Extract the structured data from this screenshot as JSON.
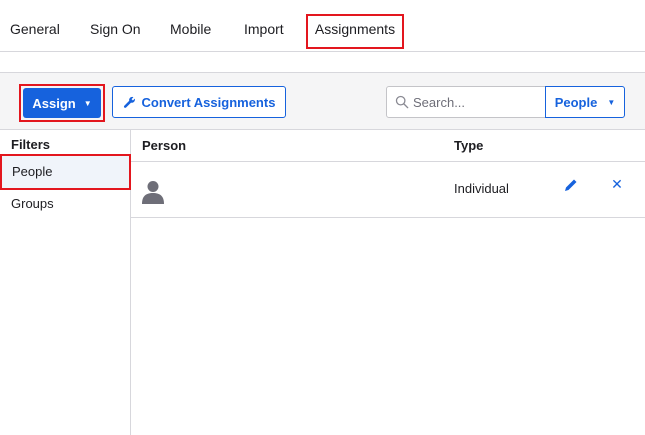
{
  "tabs": [
    {
      "label": "General"
    },
    {
      "label": "Sign On"
    },
    {
      "label": "Mobile"
    },
    {
      "label": "Import"
    },
    {
      "label": "Assignments"
    }
  ],
  "toolbar": {
    "assign_label": "Assign",
    "convert_label": "Convert Assignments",
    "search_placeholder": "Search...",
    "search_value": "",
    "scope_selected": "People"
  },
  "filters": {
    "title": "Filters",
    "items": [
      {
        "label": "People",
        "selected": true
      },
      {
        "label": "Groups",
        "selected": false
      }
    ]
  },
  "table": {
    "columns": [
      "Person",
      "Type"
    ],
    "rows": [
      {
        "person": "",
        "type": "Individual"
      }
    ]
  },
  "colors": {
    "accent": "#1662dd",
    "highlight": "#e3161e"
  },
  "icons": [
    "caret-down-icon",
    "wrench-icon",
    "search-icon",
    "person-icon",
    "pencil-icon",
    "close-icon"
  ]
}
